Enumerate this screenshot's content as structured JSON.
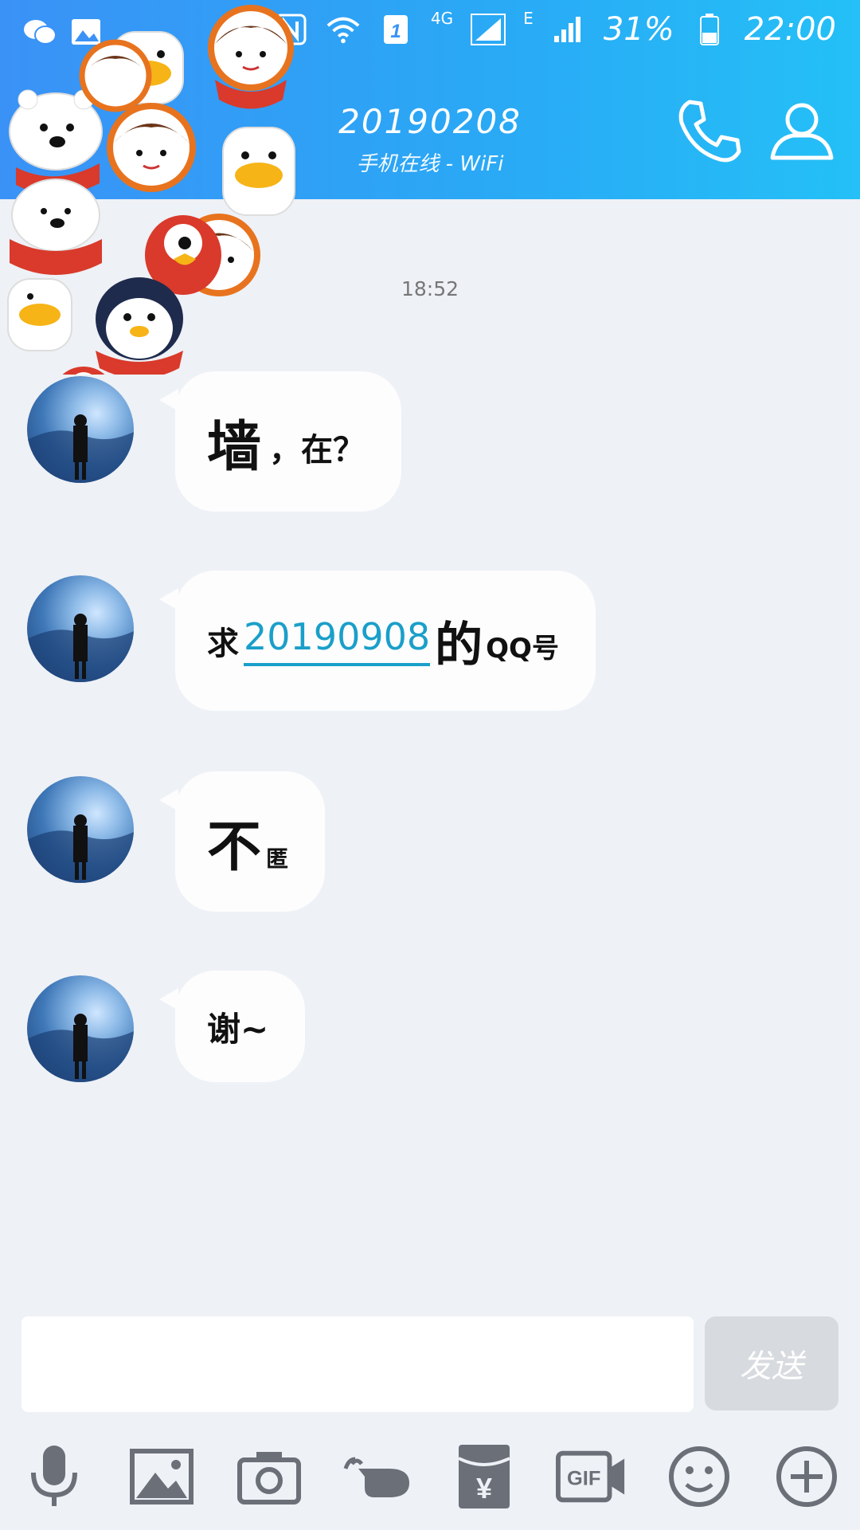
{
  "status": {
    "signal_type": "4G",
    "signal_type2": "E",
    "sim_label": "1",
    "battery": "31%",
    "time": "22:00"
  },
  "header": {
    "title": "20190208",
    "subtitle": "手机在线 - WiFi",
    "gradient_left": "#3a92f6",
    "gradient_right": "#24c0f7",
    "call_icon": "phone-icon",
    "profile_icon": "person-icon"
  },
  "timestamp": "18:52",
  "messages": [
    {
      "part1": "墙",
      "part2": "，在？"
    },
    {
      "part1": "求",
      "link": "20190908",
      "part2": "的",
      "part3": "QQ号"
    },
    {
      "part1": "不",
      "part2": "匿"
    },
    {
      "part1": "谢~"
    }
  ],
  "input": {
    "value": "",
    "send_label": "发送"
  },
  "toolbar": {
    "icons": [
      "microphone-icon",
      "image-icon",
      "camera-icon",
      "poke-icon",
      "red-packet-icon",
      "gif-icon",
      "emoji-icon",
      "plus-icon"
    ],
    "red_packet_symbol": "¥",
    "gif_label": "GIF"
  },
  "colors": {
    "accent": "#2aa8f5",
    "link": "#1a9fc9",
    "background": "#eef1f6"
  }
}
